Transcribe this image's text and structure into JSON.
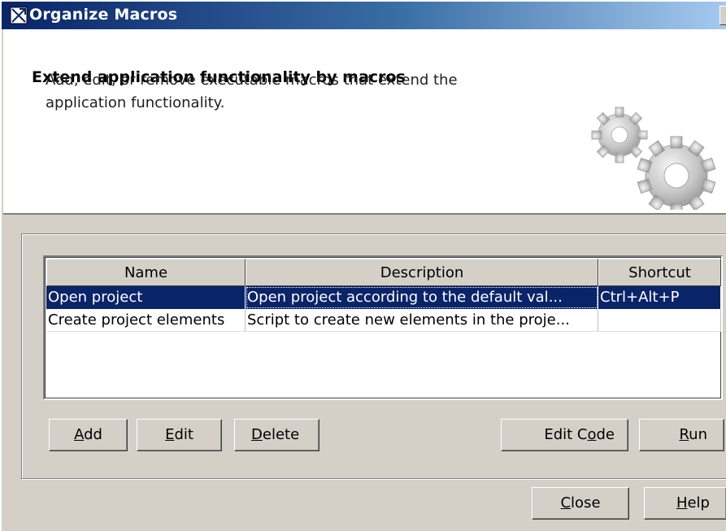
{
  "window": {
    "title": "Organize Macros"
  },
  "header": {
    "title": "Extend application functionality by macros",
    "description": "Add, edit, or remove executable macros that extend the application functionality."
  },
  "table": {
    "columns": [
      "Name",
      "Description",
      "Shortcut"
    ],
    "rows": [
      {
        "name": "Open project",
        "description": "Open project according to the default val...",
        "shortcut": "Ctrl+Alt+P",
        "selected": true
      },
      {
        "name": "Create project elements",
        "description": "Script to create new elements in the proje...",
        "shortcut": "",
        "selected": false
      }
    ]
  },
  "buttons": {
    "add": {
      "mnemonic": "A",
      "rest": "dd"
    },
    "edit": {
      "mnemonic": "E",
      "rest": "dit"
    },
    "delete": {
      "mnemonic": "D",
      "rest": "elete"
    },
    "edit_code": {
      "pre": "Edit C",
      "mnemonic": "o",
      "rest": "de"
    },
    "run": {
      "mnemonic": "R",
      "rest": "un"
    },
    "close": {
      "mnemonic": "C",
      "rest": "lose"
    },
    "help": {
      "mnemonic": "H",
      "rest": "elp"
    }
  },
  "colors": {
    "title_gradient_start": "#0a246a",
    "selection": "#0a246a",
    "dialog_bg": "#d4d0c8"
  },
  "icons": {
    "window": "macro-dialog-icon",
    "header": "gears-icon"
  }
}
